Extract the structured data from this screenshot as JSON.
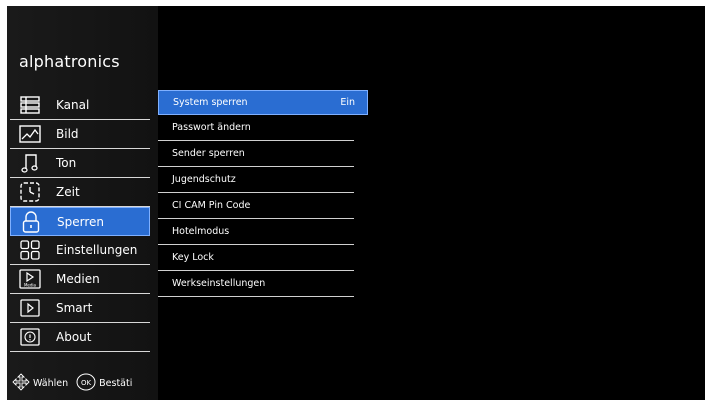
{
  "brand": "alphatronics",
  "menu": [
    {
      "label": "Kanal",
      "icon": "channel-list-icon"
    },
    {
      "label": "Bild",
      "icon": "picture-icon"
    },
    {
      "label": "Ton",
      "icon": "sound-icon"
    },
    {
      "label": "Zeit",
      "icon": "time-icon"
    },
    {
      "label": "Sperren",
      "icon": "lock-icon"
    },
    {
      "label": "Einstellungen",
      "icon": "settings-grid-icon"
    },
    {
      "label": "Medien",
      "icon": "media-icon",
      "icon_text": "Media"
    },
    {
      "label": "Smart",
      "icon": "smart-icon"
    },
    {
      "label": "About",
      "icon": "about-icon"
    }
  ],
  "active_menu": "Sperren",
  "footer": {
    "select_label": "Wählen",
    "ok_icon_text": "OK",
    "confirm_label": "Bestäti"
  },
  "submenu": [
    {
      "label": "System sperren",
      "value": "Ein"
    },
    {
      "label": "Passwort ändern",
      "value": ""
    },
    {
      "label": "Sender sperren",
      "value": ""
    },
    {
      "label": "Jugendschutz",
      "value": ""
    },
    {
      "label": "CI CAM Pin Code",
      "value": ""
    },
    {
      "label": "Hotelmodus",
      "value": ""
    },
    {
      "label": "Key Lock",
      "value": ""
    },
    {
      "label": "Werkseinstellungen",
      "value": ""
    }
  ],
  "active_submenu": "System sperren",
  "colors": {
    "accent": "#2a6dd2",
    "accent_border": "#7fb0ff",
    "background": "#000000",
    "sidebar": "#161616"
  }
}
